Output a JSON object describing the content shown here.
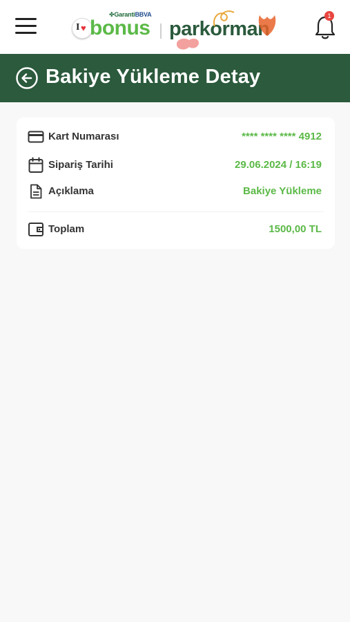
{
  "header": {
    "logo": {
      "garanti": "Garanti",
      "bbva": "BBVA",
      "bonus": "bonus",
      "parkorman": "parkorman"
    },
    "notifications": {
      "count": "1"
    }
  },
  "titlebar": {
    "title": "Bakiye Yükleme Detay"
  },
  "details": {
    "rows": [
      {
        "icon": "credit-card-icon",
        "label": "Kart Numarası",
        "value": "**** **** **** 4912"
      },
      {
        "icon": "calendar-icon",
        "label": "Sipariş Tarihi",
        "value": "29.06.2024 / 16:19"
      },
      {
        "icon": "document-icon",
        "label": "Açıklama",
        "value": "Bakiye Yükleme"
      }
    ],
    "total": {
      "icon": "wallet-icon",
      "label": "Toplam",
      "value": "1500,00 TL"
    }
  },
  "colors": {
    "brand_green": "#2b5a3c",
    "accent_green": "#5bb947",
    "badge_red": "#e8463f"
  }
}
